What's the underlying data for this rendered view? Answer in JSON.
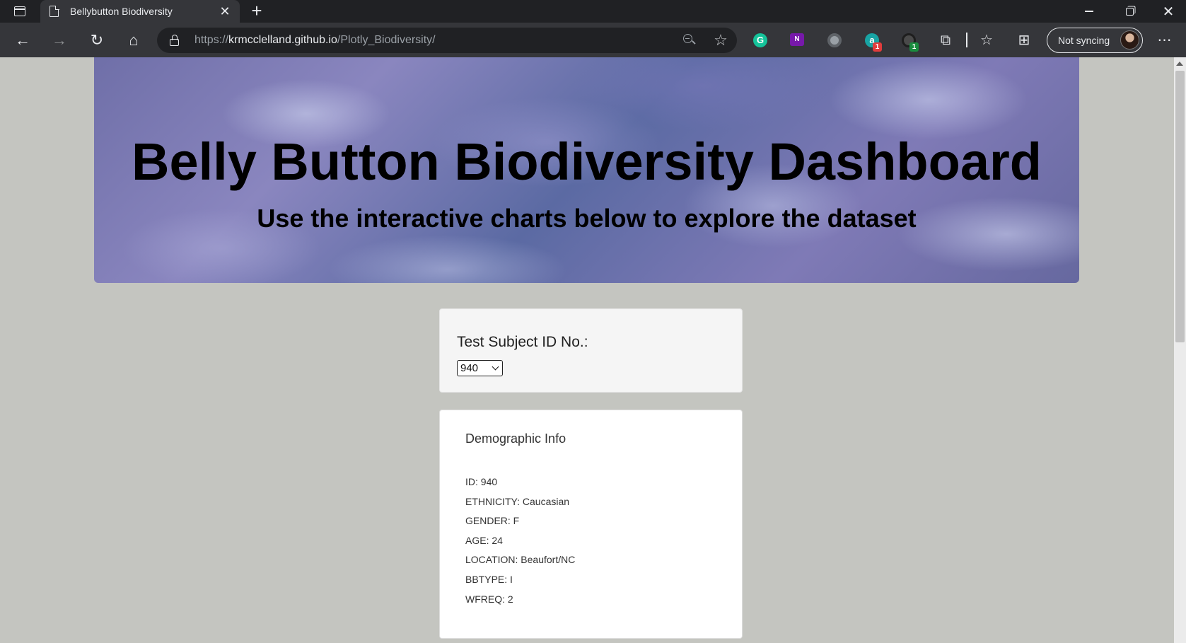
{
  "browser": {
    "tab_title": "Bellybutton Biodiversity",
    "url_scheme": "https://",
    "url_host": "krmcclelland.github.io",
    "url_path": "/Plotly_Biodiversity/",
    "profile_label": "Not syncing",
    "extension_badges": [
      "1",
      "1"
    ],
    "icons": [
      "tab-actions-icon",
      "page-icon",
      "close-icon",
      "plus-icon",
      "back-arrow-icon",
      "forward-arrow-icon",
      "reload-icon",
      "home-icon",
      "lock-icon",
      "zoom-icon",
      "add-favorite-icon",
      "grammarly-icon",
      "onenote-icon",
      "extension-icon",
      "puzzle-icon",
      "favorites-icon",
      "collections-icon",
      "more-icon"
    ]
  },
  "hero": {
    "title": "Belly Button Biodiversity Dashboard",
    "subtitle": "Use the interactive charts below to explore the dataset"
  },
  "selector": {
    "label": "Test Subject ID No.:",
    "selected": "940"
  },
  "demographics": {
    "title": "Demographic Info",
    "rows": [
      "ID: 940",
      "ETHNICITY: Caucasian",
      "GENDER: F",
      "AGE: 24",
      "LOCATION: Beaufort/NC",
      "BBTYPE: I",
      "WFREQ: 2"
    ]
  },
  "colors": {
    "page_background": "#c4c5c0",
    "chrome_dark": "#202124",
    "toolbar": "#35363a"
  }
}
